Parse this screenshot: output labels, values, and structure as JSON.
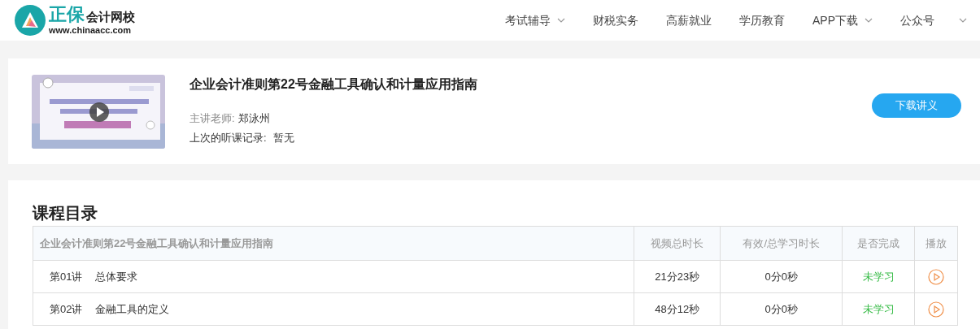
{
  "logo": {
    "brand": "正保",
    "name": "会计网校",
    "url": "www.chinaacc.com"
  },
  "nav": [
    {
      "label": "考试辅导",
      "dropdown": true
    },
    {
      "label": "财税实务",
      "dropdown": false
    },
    {
      "label": "高薪就业",
      "dropdown": false
    },
    {
      "label": "学历教育",
      "dropdown": false
    },
    {
      "label": "APP下载",
      "dropdown": true
    },
    {
      "label": "公众号",
      "dropdown": true
    }
  ],
  "course": {
    "title": "企业会计准则第22号金融工具确认和计量应用指南",
    "teacher_label": "主讲老师:",
    "teacher": "郑泳州",
    "record_label": "上次的听课记录:",
    "record": "暂无",
    "download_button": "下载讲义"
  },
  "catalog": {
    "heading": "课程目录",
    "columns": [
      "企业会计准则第22号金融工具确认和计量应用指南",
      "视频总时长",
      "有效/总学习时长",
      "是否完成",
      "播放"
    ],
    "rows": [
      {
        "lecture": "第01讲",
        "topic": "总体要求",
        "duration": "21分23秒",
        "studied": "0分0秒",
        "status": "未学习"
      },
      {
        "lecture": "第02讲",
        "topic": "金融工具的定义",
        "duration": "48分12秒",
        "studied": "0分0秒",
        "status": "未学习"
      }
    ]
  }
}
